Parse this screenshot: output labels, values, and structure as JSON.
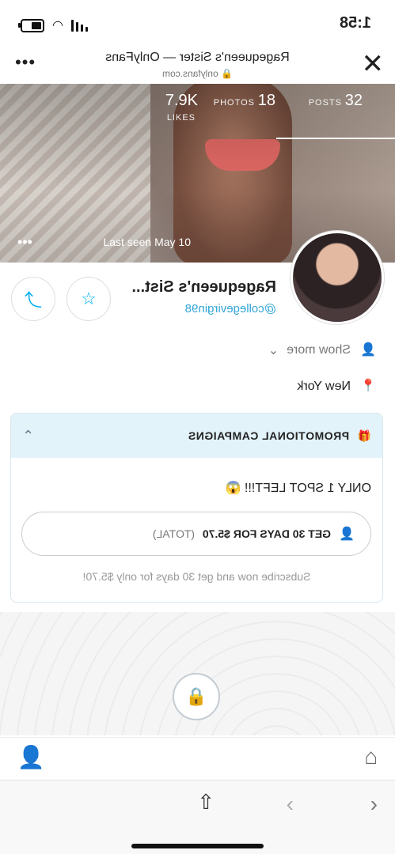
{
  "status": {
    "time": "1:58"
  },
  "browser": {
    "title": "Ragequeen's Sister — OnlyFans",
    "url": "onlyfans.com"
  },
  "profile": {
    "stats": [
      {
        "num": "32",
        "label": "POSTS"
      },
      {
        "num": "18",
        "label": "PHOTOS"
      },
      {
        "num": "7.9K",
        "label": "LIKES"
      }
    ],
    "last_seen": "Last seen May 10",
    "name": "Ragequeen's Sist...",
    "handle": "@collegevirgin98",
    "show_more": "Show more",
    "location": "New York"
  },
  "promo": {
    "header": "PROMOTIONAL CAMPAIGNS",
    "spot_text": "ONLY 1 SPOT LEFT!!! 😱",
    "button_main": "GET 30 DAYS FOR $5.70",
    "button_total": "(TOTAL)",
    "note": "Subscribe now and get 30 days for only $5.70!"
  },
  "icons": {
    "accent": "#00aff0"
  }
}
